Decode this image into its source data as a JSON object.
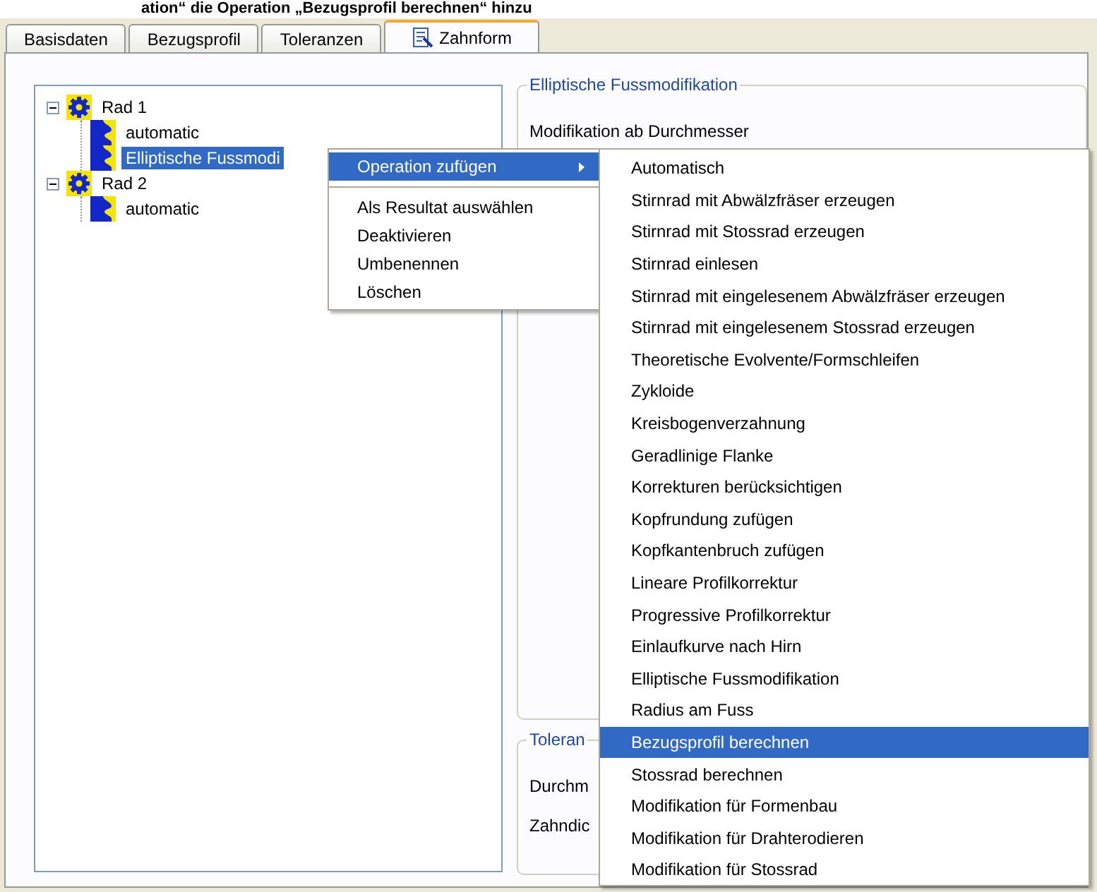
{
  "caption": "ation“ die Operation „Bezugsprofil berechnen“ hinzu",
  "tabs": [
    {
      "label": "Basisdaten",
      "selected": false
    },
    {
      "label": "Bezugsprofil",
      "selected": false
    },
    {
      "label": "Toleranzen",
      "selected": false
    },
    {
      "label": "Zahnform",
      "selected": true
    }
  ],
  "tree": [
    {
      "label": "Rad 1",
      "kind": "gear",
      "expanded": true,
      "selected": false,
      "children": [
        {
          "label": "automatic",
          "kind": "operation",
          "selected": false
        },
        {
          "label": "Elliptische Fussmodi",
          "kind": "operation",
          "selected": true
        }
      ]
    },
    {
      "label": "Rad 2",
      "kind": "gear",
      "expanded": true,
      "selected": false,
      "children": [
        {
          "label": "automatic",
          "kind": "operation",
          "selected": false
        }
      ]
    }
  ],
  "groups": [
    {
      "title": "Elliptische Fussmodifikation",
      "fields": [
        "Modifikation ab Durchmesser"
      ]
    },
    {
      "title": "Toleran",
      "fields": [
        "Durchm",
        "Zahndic"
      ]
    }
  ],
  "context_menu": {
    "items": [
      {
        "label": "Operation zufügen",
        "kind": "submenu",
        "selected": true
      },
      {
        "kind": "separator"
      },
      {
        "label": "Als Resultat auswählen",
        "kind": "item",
        "selected": false
      },
      {
        "label": "Deaktivieren",
        "kind": "item",
        "selected": false
      },
      {
        "label": "Umbenennen",
        "kind": "item",
        "selected": false
      },
      {
        "label": "Löschen",
        "kind": "item",
        "selected": false
      }
    ]
  },
  "submenu": {
    "items": [
      {
        "label": "Automatisch",
        "selected": false
      },
      {
        "label": "Stirnrad mit Abwälzfräser erzeugen",
        "selected": false
      },
      {
        "label": "Stirnrad mit Stossrad erzeugen",
        "selected": false
      },
      {
        "label": "Stirnrad einlesen",
        "selected": false
      },
      {
        "label": "Stirnrad mit eingelesenem Abwälzfräser erzeugen",
        "selected": false
      },
      {
        "label": "Stirnrad mit eingelesenem Stossrad erzeugen",
        "selected": false
      },
      {
        "label": "Theoretische Evolvente/Formschleifen",
        "selected": false
      },
      {
        "label": "Zykloide",
        "selected": false
      },
      {
        "label": "Kreisbogenverzahnung",
        "selected": false
      },
      {
        "label": "Geradlinige Flanke",
        "selected": false
      },
      {
        "label": "Korrekturen berücksichtigen",
        "selected": false
      },
      {
        "label": "Kopfrundung zufügen",
        "selected": false
      },
      {
        "label": "Kopfkantenbruch zufügen",
        "selected": false
      },
      {
        "label": "Lineare Profilkorrektur",
        "selected": false
      },
      {
        "label": "Progressive Profilkorrektur",
        "selected": false
      },
      {
        "label": "Einlaufkurve nach Hirn",
        "selected": false
      },
      {
        "label": "Elliptische Fussmodifikation",
        "selected": false
      },
      {
        "label": "Radius am Fuss",
        "selected": false
      },
      {
        "label": "Bezugsprofil berechnen",
        "selected": true
      },
      {
        "label": "Stossrad berechnen",
        "selected": false
      },
      {
        "label": "Modifikation für Formenbau",
        "selected": false
      },
      {
        "label": "Modifikation für Drahterodieren",
        "selected": false
      },
      {
        "label": "Modifikation für Stossrad",
        "selected": false
      }
    ]
  }
}
